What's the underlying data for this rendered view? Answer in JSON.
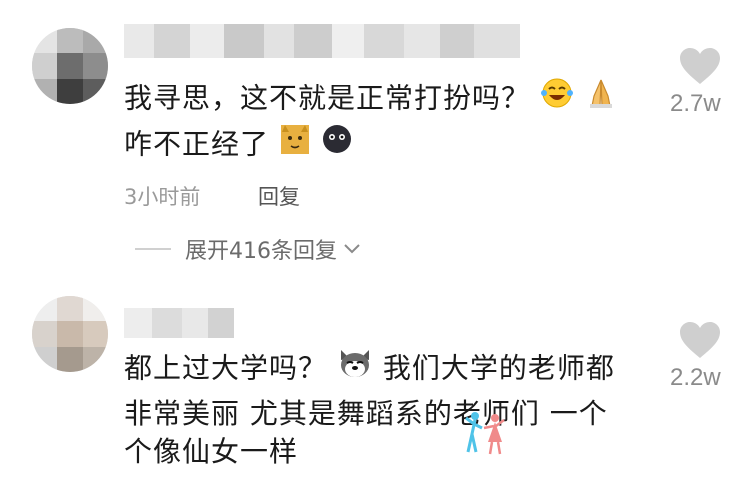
{
  "comments": [
    {
      "text_line1": "我寻思，这不就是正常打扮吗？",
      "text_line2": "咋不正经了",
      "time": "3小时前",
      "reply_label": "回复",
      "likes": "2.7w",
      "expand_label": "展开416条回复",
      "emoji_line1": [
        "laughing-crying-emoji-icon",
        "praying-hands-emoji-icon"
      ],
      "emoji_line2": [
        "cat-emoji-icon",
        "dark-face-emoji-icon"
      ]
    },
    {
      "text_line1": "都上过大学吗？",
      "text_line1b": "我们大学的老师都",
      "text_line2": "非常美丽 尤其是舞蹈系的老师们 一个",
      "text_line3": "个像仙女一样",
      "likes": "2.2w",
      "emoji_line1": [
        "husky-dog-emoji-icon"
      ],
      "emoji_inline": [
        "dancing-couple-emoji-icon"
      ]
    }
  ],
  "colors": {
    "text": "#1a1a1a",
    "meta": "#9a9a9a",
    "heart": "#c8c8c8"
  }
}
